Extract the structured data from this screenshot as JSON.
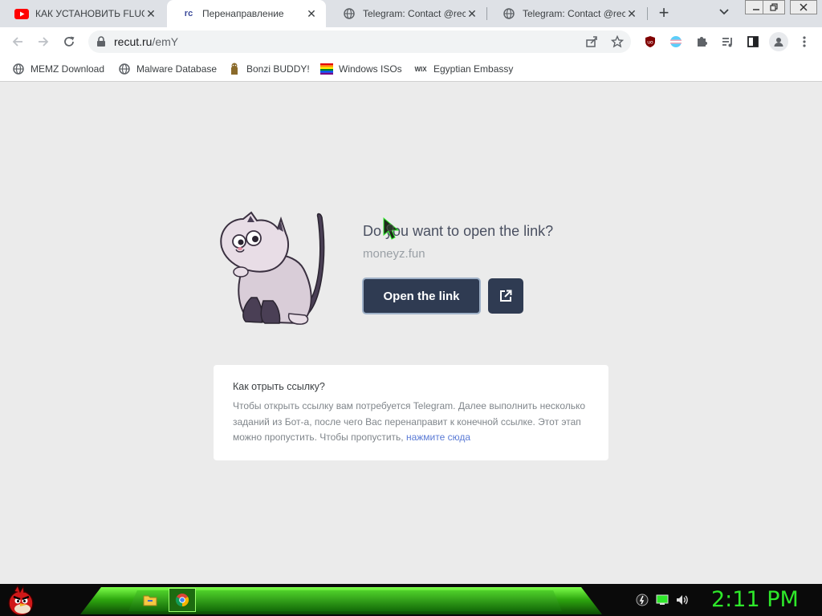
{
  "browser": {
    "tabs": [
      {
        "title": "КАК УСТАНОВИТЬ FLUGF",
        "icon": "youtube-icon",
        "active": false
      },
      {
        "title": "Перенаправление",
        "icon": "recut-icon",
        "favicon_text": "rc",
        "active": true
      },
      {
        "title": "Telegram: Contact @recut",
        "icon": "globe-icon",
        "active": false
      },
      {
        "title": "Telegram: Contact @recut",
        "icon": "globe-icon",
        "active": false
      }
    ],
    "new_tab_label": "+",
    "url_host": "recut.ru",
    "url_path": "/emY",
    "bookmarks": [
      {
        "label": "MEMZ Download",
        "icon": "globe-icon"
      },
      {
        "label": "Malware Database",
        "icon": "globe-icon"
      },
      {
        "label": "Bonzi BUDDY!",
        "icon": "bonzi-icon"
      },
      {
        "label": "Windows ISOs",
        "icon": "windows-icon"
      },
      {
        "label": "Egyptian Embassy",
        "icon": "wix-icon",
        "icon_text": "WIX"
      }
    ]
  },
  "page": {
    "prompt": "Do you want to open the link?",
    "domain": "moneyz.fun",
    "open_button": "Open the link",
    "help_title": "Как отрыть ссылку?",
    "help_text": "Чтобы открыть ссылку вам потребуется Telegram. Далее выполнить несколько заданий из Бот-а, после чего Вас перенаправит к конечной ссылке. Этот этап можно пропустить. Чтобы пропустить, ",
    "help_link": "нажмите сюда"
  },
  "taskbar": {
    "clock": "2:11 PM"
  },
  "colors": {
    "button_bg": "#2f3b52",
    "link": "#5b7bd5",
    "clock": "#2ee82a"
  }
}
